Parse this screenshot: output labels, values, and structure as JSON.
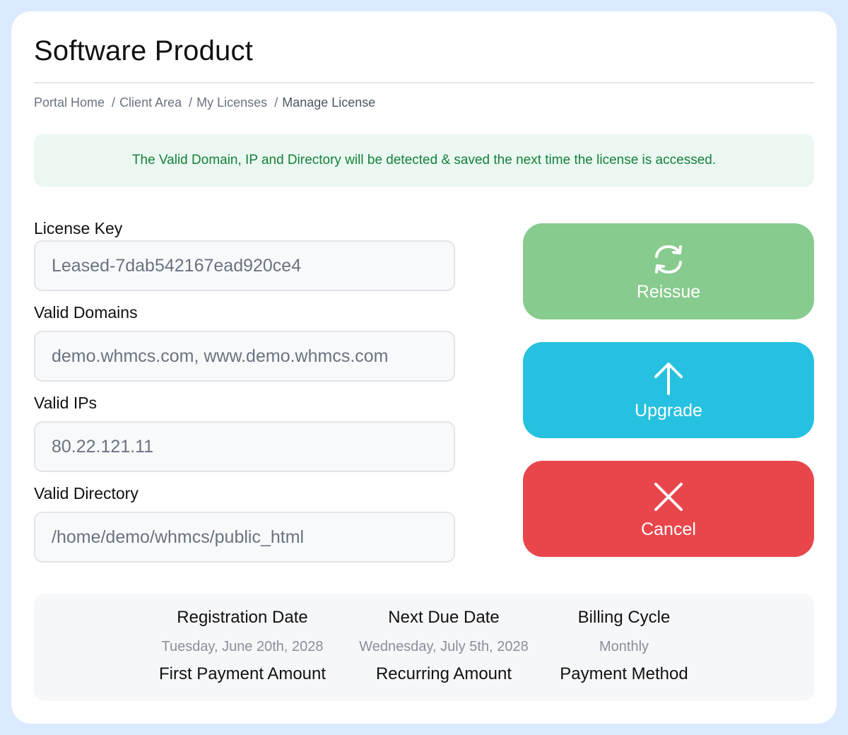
{
  "page": {
    "title": "Software Product"
  },
  "breadcrumb": {
    "items": [
      "Portal Home",
      "Client Area",
      "My Licenses"
    ],
    "separator": "/",
    "current": "Manage License"
  },
  "alert": {
    "message": "The Valid Domain, IP and Directory will be detected & saved the next time the license is accessed.",
    "color": "#15803d"
  },
  "fields": {
    "license_key": {
      "label": "License Key",
      "value": "Leased-7dab542167ead920ce4"
    },
    "valid_domains": {
      "label": "Valid Domains",
      "value": "demo.whmcs.com, www.demo.whmcs.com"
    },
    "valid_ips": {
      "label": "Valid IPs",
      "value": "80.22.121.11"
    },
    "valid_directory": {
      "label": "Valid Directory",
      "value": "/home/demo/whmcs/public_html"
    }
  },
  "actions": {
    "reissue": {
      "label": "Reissue",
      "icon": "refresh-icon",
      "color": "#88cb8e"
    },
    "upgrade": {
      "label": "Upgrade",
      "icon": "arrow-up-icon",
      "color": "#26c1e0"
    },
    "cancel": {
      "label": "Cancel",
      "icon": "close-icon",
      "color": "#e9464c"
    }
  },
  "info": {
    "registration_date": {
      "label": "Registration Date",
      "value": "Tuesday, June 20th, 2028"
    },
    "next_due_date": {
      "label": "Next Due Date",
      "value": "Wednesday, July 5th, 2028"
    },
    "billing_cycle": {
      "label": "Billing Cycle",
      "value": "Monthly"
    },
    "first_payment_amount": {
      "label": "First Payment Amount"
    },
    "recurring_amount": {
      "label": "Recurring Amount"
    },
    "payment_method": {
      "label": "Payment Method"
    }
  }
}
